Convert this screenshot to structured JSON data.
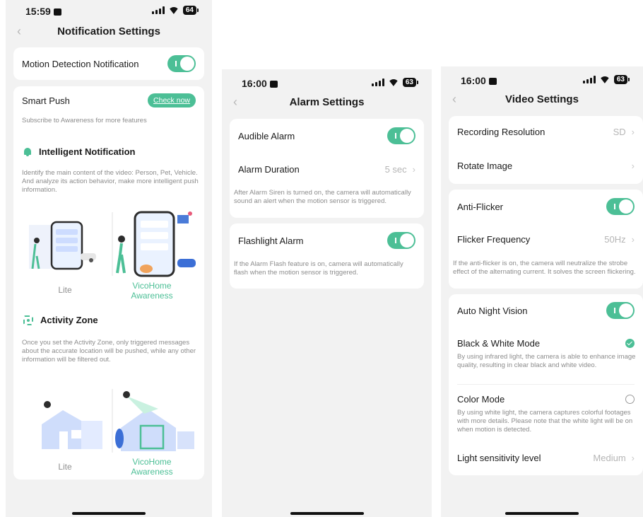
{
  "status": {
    "s1": {
      "time": "15:59",
      "battery": "64"
    },
    "s2": {
      "time": "16:00",
      "battery": "63"
    },
    "s3": {
      "time": "16:00",
      "battery": "63"
    }
  },
  "notification": {
    "title": "Notification Settings",
    "motion_label": "Motion Detection Notification",
    "motion_on": true,
    "smart_push_label": "Smart Push",
    "check_now": "Check now",
    "subscribe_text": "Subscribe to Awareness for more features",
    "intelligent_title": "Intelligent Notification",
    "intelligent_desc": "Identify the main content of the video: Person, Pet, Vehicle. And analyze its action behavior, make more intelligent push information.",
    "lite_label": "Lite",
    "awareness_label_1": "VicoHome",
    "awareness_label_2": "Awareness",
    "zone_title": "Activity Zone",
    "zone_desc": "Once you set the Activity Zone, only triggered messages about the accurate location will be pushed, while any other information will be filtered out."
  },
  "alarm": {
    "title": "Alarm Settings",
    "audible_label": "Audible Alarm",
    "audible_on": true,
    "duration_label": "Alarm Duration",
    "duration_value": "5 sec",
    "siren_desc": "After Alarm Siren is turned on, the camera will automatically sound an alert when the motion sensor is triggered.",
    "flash_label": "Flashlight Alarm",
    "flash_on": true,
    "flash_desc": "If the Alarm Flash feature is on, camera will automatically flash when the motion sensor is triggered."
  },
  "video": {
    "title": "Video Settings",
    "resolution_label": "Recording Resolution",
    "resolution_value": "SD",
    "rotate_label": "Rotate Image",
    "antiflicker_label": "Anti-Flicker",
    "antiflicker_on": true,
    "flicker_label": "Flicker Frequency",
    "flicker_value": "50Hz",
    "flicker_desc": "If the anti-flicker is on, the camera will neutralize the strobe effect of the alternating current. It solves the screen flickering.",
    "night_label": "Auto Night Vision",
    "night_on": true,
    "bw_label": "Black & White Mode",
    "bw_selected": true,
    "bw_desc": "By using infrared light, the camera is able to enhance image quality, resulting in clear black and white video.",
    "color_label": "Color Mode",
    "color_selected": false,
    "color_desc": "By using white light, the camera captures colorful footages with more details. Please note that the white light will be on when motion is detected.",
    "sensitivity_label": "Light sensitivity level",
    "sensitivity_value": "Medium"
  },
  "colors": {
    "accent": "#4cbf96",
    "background": "#f2f2f2",
    "card": "#ffffff"
  }
}
